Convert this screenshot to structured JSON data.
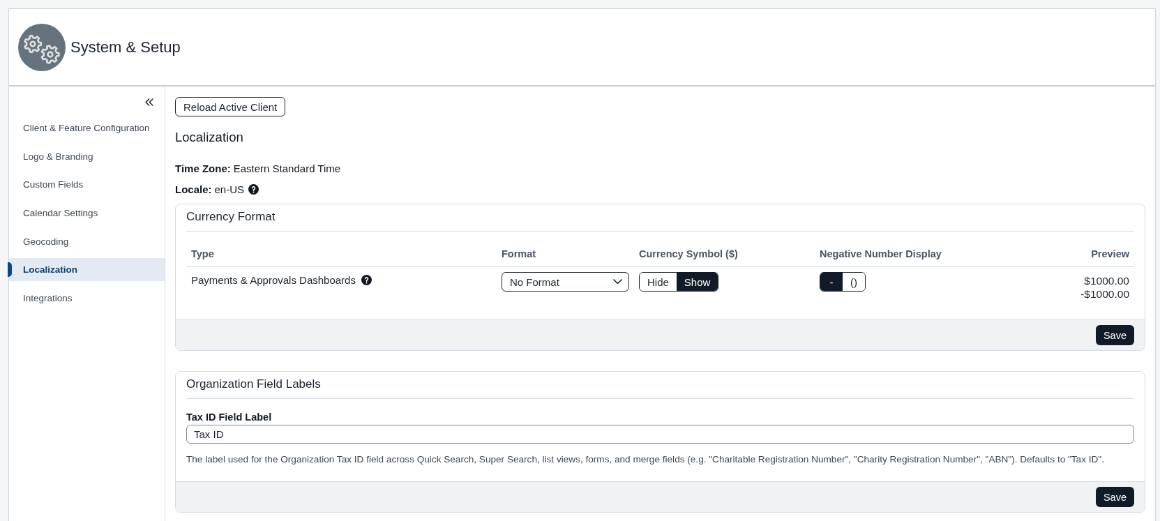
{
  "header": {
    "title": "System & Setup"
  },
  "sidebar": {
    "items": [
      {
        "label": "Client & Feature Configuration",
        "selected": false
      },
      {
        "label": "Logo & Branding",
        "selected": false
      },
      {
        "label": "Custom Fields",
        "selected": false
      },
      {
        "label": "Calendar Settings",
        "selected": false
      },
      {
        "label": "Geocoding",
        "selected": false
      },
      {
        "label": "Localization",
        "selected": true
      },
      {
        "label": "Integrations",
        "selected": false
      }
    ]
  },
  "content": {
    "reload_button": "Reload Active Client",
    "heading": "Localization",
    "fields": [
      {
        "label": "Time Zone:",
        "value": "Eastern Standard Time",
        "help_icon": false
      },
      {
        "label": "Locale:",
        "value": "en-US",
        "help_icon": true
      }
    ]
  },
  "currency_format": {
    "title": "Currency Format",
    "columns": [
      "Type",
      "Format",
      "Currency Symbol ($)",
      "Negative Number Display",
      "Preview"
    ],
    "rows": [
      {
        "type": "Payments & Approvals Dashboards",
        "help_icon": true,
        "format": "No Format",
        "currency_symbol": [
          {
            "label": "Hide",
            "selected": false
          },
          {
            "label": "Show",
            "selected": true
          }
        ],
        "negative_display": [
          {
            "label": "-",
            "selected": true
          },
          {
            "label": "()",
            "selected": false
          }
        ],
        "preview": [
          "$1000.00",
          "-$1000.00"
        ]
      }
    ],
    "save_button": "Save"
  },
  "organization_field_labels": {
    "title": "Organization Field Labels",
    "field_label": "Tax ID Field Label",
    "value": "Tax ID",
    "help_text": "The label used for the Organization Tax ID field across Quick Search, Super Search, list views, forms, and merge fields (e.g. \"Charitable Registration Number\", \"Charity Registration Number\", \"ABN\"). Defaults to \"Tax ID\".",
    "save_button": "Save"
  }
}
